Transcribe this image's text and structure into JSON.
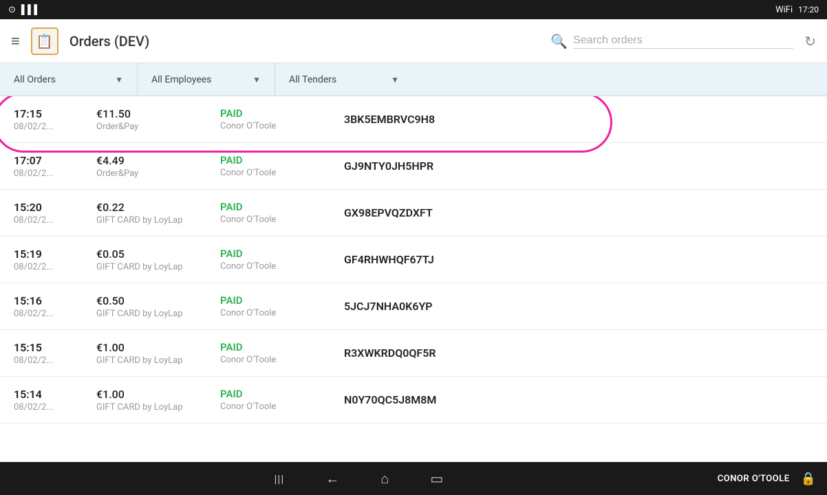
{
  "statusBar": {
    "leftIcons": [
      "clock-icon",
      "signal-bars-icon"
    ],
    "time": "17:20",
    "wifiIcon": "wifi-icon"
  },
  "appBar": {
    "menuIcon": "≡",
    "logoIcon": "📋",
    "title": "Orders (DEV)",
    "searchPlaceholder": "Search orders",
    "refreshIcon": "↻"
  },
  "filterBar": {
    "filters": [
      {
        "label": "All Orders"
      },
      {
        "label": "All Employees"
      },
      {
        "label": "All Tenders"
      }
    ]
  },
  "orders": [
    {
      "time": "17:15",
      "date": "08/02/2...",
      "amount": "€11.50",
      "method": "Order&Pay",
      "status": "PAID",
      "employee": "Conor O'Toole",
      "orderId": "3BK5EMBRVC9H8",
      "highlighted": true
    },
    {
      "time": "17:07",
      "date": "08/02/2...",
      "amount": "€4.49",
      "method": "Order&Pay",
      "status": "PAID",
      "employee": "Conor O'Toole",
      "orderId": "GJ9NTY0JH5HPR",
      "highlighted": false
    },
    {
      "time": "15:20",
      "date": "08/02/2...",
      "amount": "€0.22",
      "method": "GIFT CARD by LoyLap",
      "status": "PAID",
      "employee": "Conor O'Toole",
      "orderId": "GX98EPVQZDXFT",
      "highlighted": false
    },
    {
      "time": "15:19",
      "date": "08/02/2...",
      "amount": "€0.05",
      "method": "GIFT CARD by LoyLap",
      "status": "PAID",
      "employee": "Conor O'Toole",
      "orderId": "GF4RHWHQF67TJ",
      "highlighted": false
    },
    {
      "time": "15:16",
      "date": "08/02/2...",
      "amount": "€0.50",
      "method": "GIFT CARD by LoyLap",
      "status": "PAID",
      "employee": "Conor O'Toole",
      "orderId": "5JCJ7NHA0K6YP",
      "highlighted": false
    },
    {
      "time": "15:15",
      "date": "08/02/2...",
      "amount": "€1.00",
      "method": "GIFT CARD by LoyLap",
      "status": "PAID",
      "employee": "Conor O'Toole",
      "orderId": "R3XWKRDQ0QF5R",
      "highlighted": false
    },
    {
      "time": "15:14",
      "date": "08/02/2...",
      "amount": "€1.00",
      "method": "GIFT CARD by LoyLap",
      "status": "PAID",
      "employee": "Conor O'Toole",
      "orderId": "N0Y70QC5J8M8M",
      "highlighted": false
    }
  ],
  "bottomNav": {
    "barcodeIcon": "|||",
    "backIcon": "←",
    "homeIcon": "⌂",
    "recentIcon": "▭",
    "userName": "CONOR O'TOOLE",
    "lockIcon": "🔒"
  }
}
